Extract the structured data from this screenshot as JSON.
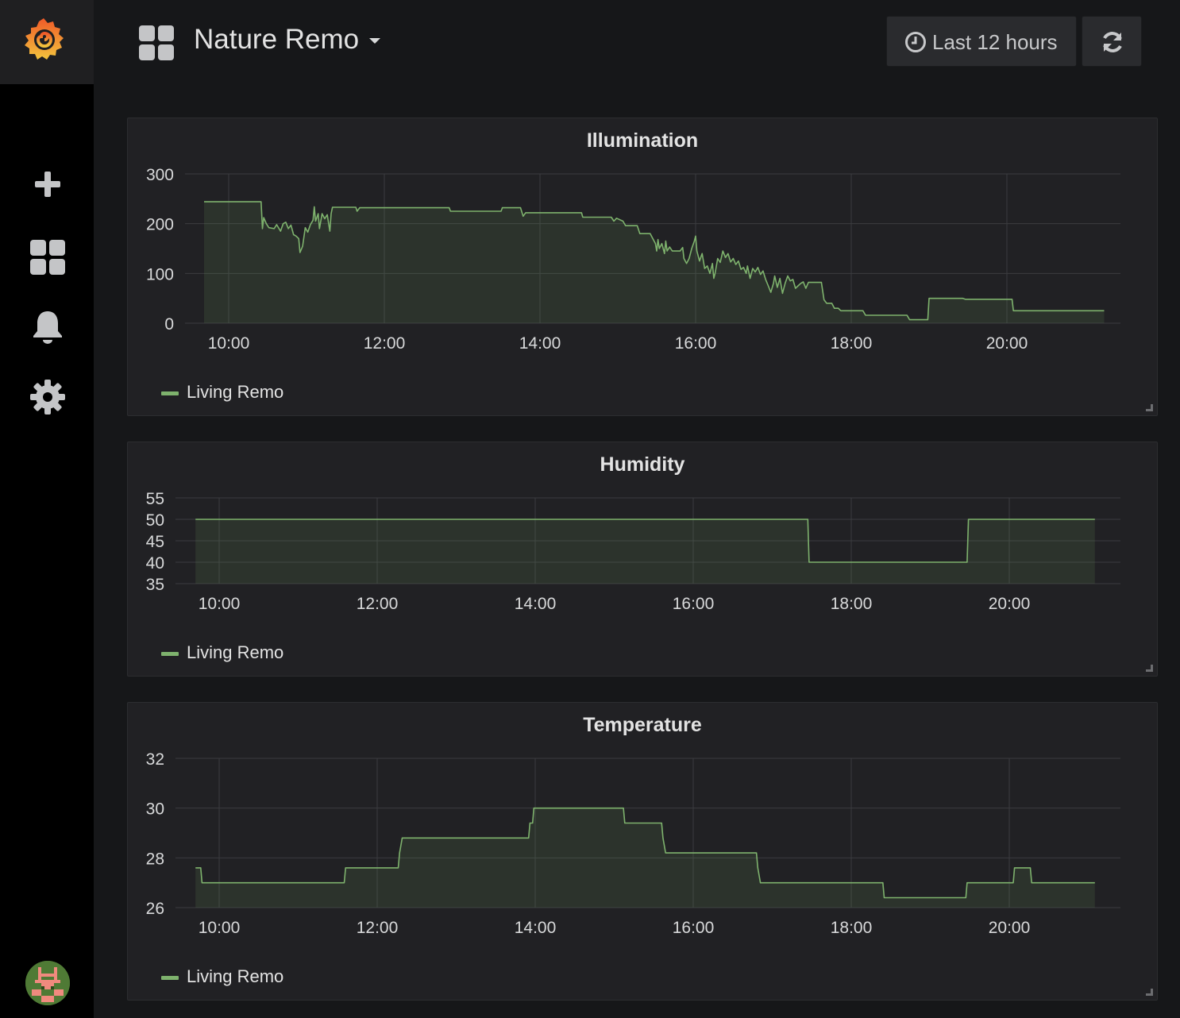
{
  "header": {
    "dashboard_title": "Nature Remo",
    "time_range_label": "Last 12 hours"
  },
  "sidebar": {
    "items": [
      {
        "name": "create",
        "icon": "plus-icon"
      },
      {
        "name": "dashboards",
        "icon": "dashboard-grid-icon"
      },
      {
        "name": "alerting",
        "icon": "bell-icon"
      },
      {
        "name": "configuration",
        "icon": "gear-icon"
      }
    ]
  },
  "colors": {
    "series": "#7eb26d",
    "panel_bg": "#212124",
    "page_bg": "#161719",
    "grid": "#3b3c3f"
  },
  "chart_data": [
    {
      "type": "area",
      "title": "Illumination",
      "x_ticks": [
        "10:00",
        "12:00",
        "14:00",
        "16:00",
        "18:00",
        "20:00"
      ],
      "y_ticks": [
        0,
        100,
        200,
        300
      ],
      "ylim": [
        0,
        300
      ],
      "xlim": [
        "09:41",
        "21:15"
      ],
      "legend": [
        "Living Remo"
      ],
      "series": [
        {
          "name": "Living Remo",
          "points": [
            [
              "09:41",
              244
            ],
            [
              "10:25",
              244
            ],
            [
              "10:26",
              190
            ],
            [
              "10:27",
              212
            ],
            [
              "10:29",
              200
            ],
            [
              "10:31",
              192
            ],
            [
              "10:35",
              190
            ],
            [
              "10:37",
              198
            ],
            [
              "10:40",
              185
            ],
            [
              "10:42",
              200
            ],
            [
              "10:44",
              203
            ],
            [
              "10:46",
              190
            ],
            [
              "10:48",
              197
            ],
            [
              "10:50",
              178
            ],
            [
              "10:52",
              175
            ],
            [
              "10:54",
              170
            ],
            [
              "10:55",
              142
            ],
            [
              "10:57",
              155
            ],
            [
              "10:59",
              192
            ],
            [
              "11:01",
              183
            ],
            [
              "11:03",
              198
            ],
            [
              "11:05",
              207
            ],
            [
              "11:06",
              234
            ],
            [
              "11:07",
              205
            ],
            [
              "11:09",
              220
            ],
            [
              "11:10",
              190
            ],
            [
              "11:12",
              220
            ],
            [
              "11:14",
              210
            ],
            [
              "11:16",
              218
            ],
            [
              "11:18",
              185
            ],
            [
              "11:19",
              220
            ],
            [
              "11:20",
              233
            ],
            [
              "11:38",
              233
            ],
            [
              "11:39",
              225
            ],
            [
              "11:41",
              232
            ],
            [
              "12:50",
              232
            ],
            [
              "12:51",
              225
            ],
            [
              "13:30",
              225
            ],
            [
              "13:31",
              232
            ],
            [
              "13:45",
              232
            ],
            [
              "13:47",
              215
            ],
            [
              "13:49",
              222
            ],
            [
              "14:32",
              222
            ],
            [
              "14:33",
              213
            ],
            [
              "14:55",
              213
            ],
            [
              "14:57",
              205
            ],
            [
              "14:59",
              211
            ],
            [
              "15:04",
              205
            ],
            [
              "15:06",
              196
            ],
            [
              "15:15",
              196
            ],
            [
              "15:17",
              180
            ],
            [
              "15:25",
              180
            ],
            [
              "15:27",
              170
            ],
            [
              "15:29",
              160
            ],
            [
              "15:30",
              145
            ],
            [
              "15:31",
              168
            ],
            [
              "15:32",
              150
            ],
            [
              "15:34",
              160
            ],
            [
              "15:36",
              140
            ],
            [
              "15:37",
              165
            ],
            [
              "15:38",
              145
            ],
            [
              "15:40",
              153
            ],
            [
              "15:42",
              145
            ],
            [
              "15:48",
              145
            ],
            [
              "15:50",
              152
            ],
            [
              "15:51",
              130
            ],
            [
              "15:53",
              120
            ],
            [
              "15:55",
              130
            ],
            [
              "15:57",
              150
            ],
            [
              "15:59",
              165
            ],
            [
              "16:00",
              175
            ],
            [
              "16:01",
              145
            ],
            [
              "16:03",
              125
            ],
            [
              "16:05",
              140
            ],
            [
              "16:07",
              110
            ],
            [
              "16:09",
              115
            ],
            [
              "16:11",
              100
            ],
            [
              "16:13",
              120
            ],
            [
              "16:14",
              90
            ],
            [
              "16:15",
              100
            ],
            [
              "16:17",
              130
            ],
            [
              "16:19",
              122
            ],
            [
              "16:21",
              145
            ],
            [
              "16:23",
              132
            ],
            [
              "16:25",
              140
            ],
            [
              "16:27",
              123
            ],
            [
              "16:29",
              130
            ],
            [
              "16:31",
              118
            ],
            [
              "16:33",
              125
            ],
            [
              "16:35",
              108
            ],
            [
              "16:37",
              112
            ],
            [
              "16:39",
              100
            ],
            [
              "16:40",
              115
            ],
            [
              "16:42",
              90
            ],
            [
              "16:44",
              110
            ],
            [
              "16:46",
              103
            ],
            [
              "16:48",
              112
            ],
            [
              "16:50",
              98
            ],
            [
              "16:52",
              105
            ],
            [
              "16:54",
              88
            ],
            [
              "16:56",
              75
            ],
            [
              "16:58",
              62
            ],
            [
              "17:00",
              80
            ],
            [
              "17:01",
              95
            ],
            [
              "17:03",
              72
            ],
            [
              "17:05",
              90
            ],
            [
              "17:07",
              60
            ],
            [
              "17:09",
              80
            ],
            [
              "17:11",
              95
            ],
            [
              "17:13",
              85
            ],
            [
              "17:15",
              88
            ],
            [
              "17:17",
              70
            ],
            [
              "17:19",
              75
            ],
            [
              "17:21",
              80
            ],
            [
              "17:23",
              83
            ],
            [
              "17:25",
              70
            ],
            [
              "17:27",
              82
            ],
            [
              "17:37",
              82
            ],
            [
              "17:39",
              47
            ],
            [
              "17:41",
              40
            ],
            [
              "17:45",
              40
            ],
            [
              "17:47",
              30
            ],
            [
              "17:50",
              30
            ],
            [
              "17:52",
              25
            ],
            [
              "18:09",
              25
            ],
            [
              "18:11",
              16
            ],
            [
              "18:43",
              16
            ],
            [
              "18:45",
              7
            ],
            [
              "18:59",
              7
            ],
            [
              "19:00",
              50
            ],
            [
              "19:26",
              50
            ],
            [
              "19:28",
              48
            ],
            [
              "20:04",
              48
            ],
            [
              "20:05",
              25
            ],
            [
              "21:15",
              25
            ]
          ]
        }
      ]
    },
    {
      "type": "area",
      "title": "Humidity",
      "x_ticks": [
        "10:00",
        "12:00",
        "14:00",
        "16:00",
        "18:00",
        "20:00"
      ],
      "y_ticks": [
        35,
        40,
        45,
        50,
        55
      ],
      "ylim": [
        35,
        55
      ],
      "xlim": [
        "09:42",
        "21:05"
      ],
      "legend": [
        "Living Remo"
      ],
      "series": [
        {
          "name": "Living Remo",
          "points": [
            [
              "09:42",
              50
            ],
            [
              "17:27",
              50
            ],
            [
              "17:28",
              40
            ],
            [
              "19:28",
              40
            ],
            [
              "19:29",
              50
            ],
            [
              "21:05",
              50
            ]
          ]
        }
      ]
    },
    {
      "type": "area",
      "title": "Temperature",
      "x_ticks": [
        "10:00",
        "12:00",
        "14:00",
        "16:00",
        "18:00",
        "20:00"
      ],
      "y_ticks": [
        26,
        28,
        30,
        32
      ],
      "ylim": [
        26,
        32
      ],
      "xlim": [
        "09:42",
        "21:05"
      ],
      "legend": [
        "Living Remo"
      ],
      "series": [
        {
          "name": "Living Remo",
          "points": [
            [
              "09:42",
              27.6
            ],
            [
              "09:46",
              27.6
            ],
            [
              "09:47",
              27.0
            ],
            [
              "11:35",
              27.0
            ],
            [
              "11:36",
              27.6
            ],
            [
              "12:16",
              27.6
            ],
            [
              "12:17",
              28.2
            ],
            [
              "12:19",
              28.8
            ],
            [
              "13:55",
              28.8
            ],
            [
              "13:56",
              29.4
            ],
            [
              "13:58",
              29.4
            ],
            [
              "13:59",
              30.0
            ],
            [
              "15:07",
              30.0
            ],
            [
              "15:08",
              29.4
            ],
            [
              "15:36",
              29.4
            ],
            [
              "15:37",
              28.8
            ],
            [
              "15:39",
              28.2
            ],
            [
              "16:48",
              28.2
            ],
            [
              "16:49",
              27.6
            ],
            [
              "16:51",
              27.0
            ],
            [
              "18:24",
              27.0
            ],
            [
              "18:25",
              26.4
            ],
            [
              "19:27",
              26.4
            ],
            [
              "19:28",
              27.0
            ],
            [
              "20:03",
              27.0
            ],
            [
              "20:04",
              27.6
            ],
            [
              "20:16",
              27.6
            ],
            [
              "20:17",
              27.0
            ],
            [
              "21:05",
              27.0
            ]
          ]
        }
      ]
    }
  ]
}
